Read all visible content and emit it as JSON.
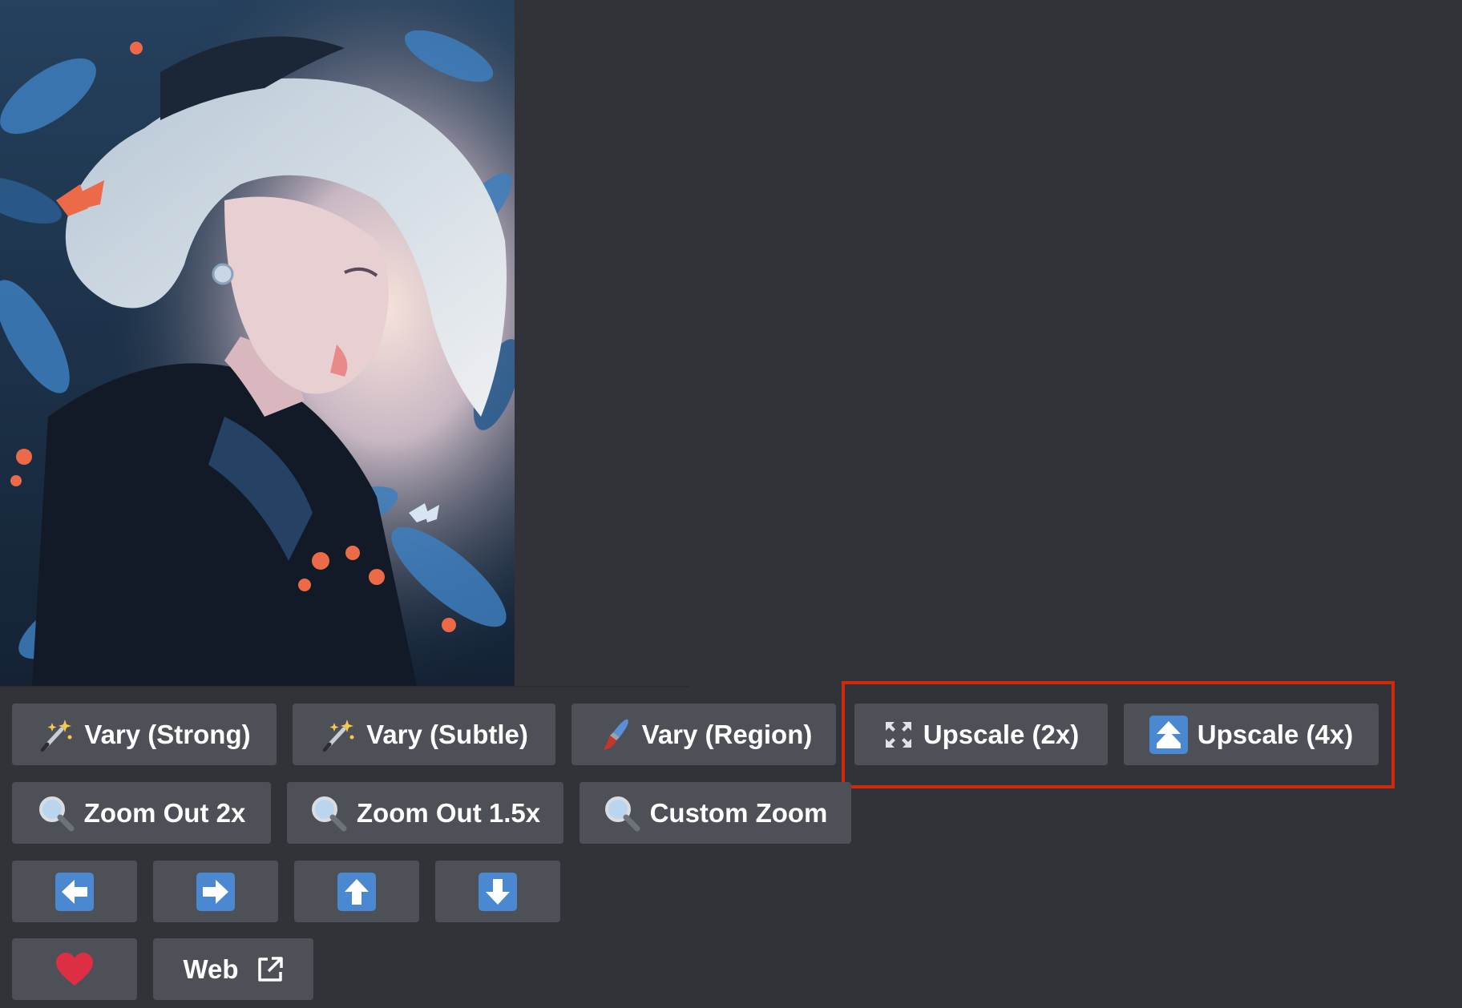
{
  "image": {
    "alt": ""
  },
  "buttons": {
    "row1": {
      "vary_strong": "Vary (Strong)",
      "vary_subtle": "Vary (Subtle)",
      "vary_region": "Vary (Region)",
      "upscale_2x": "Upscale (2x)",
      "upscale_4x": "Upscale (4x)"
    },
    "row2": {
      "zoom_out_2x": "Zoom Out 2x",
      "zoom_out_15x": "Zoom Out 1.5x",
      "custom_zoom": "Custom Zoom"
    },
    "row4": {
      "web": "Web"
    }
  },
  "icons": {
    "vary": "magic-wand-icon",
    "region": "paintbrush-icon",
    "upscale2": "expand-arrows-icon",
    "upscale4": "upload-arrow-icon",
    "zoom": "magnifier-icon",
    "pan_left": "arrow-left-icon",
    "pan_right": "arrow-right-icon",
    "pan_up": "arrow-up-icon",
    "pan_down": "arrow-down-icon",
    "favorite": "heart-icon",
    "external": "external-link-icon"
  },
  "colors": {
    "background": "#313338",
    "button": "#4e5058",
    "highlight": "#d12a0b",
    "arrow_tile": "#4a89d1",
    "heart": "#dd2e44"
  }
}
